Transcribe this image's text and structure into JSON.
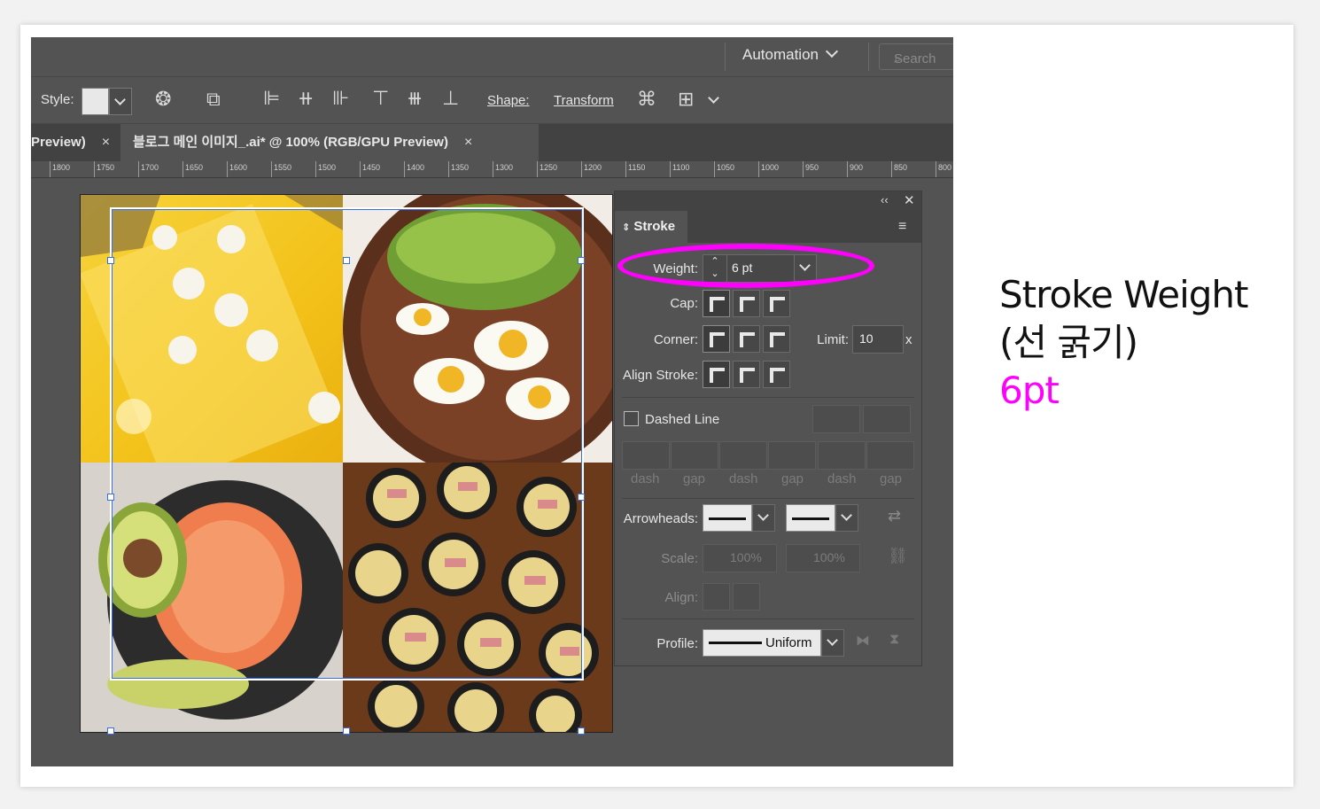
{
  "topbar": {
    "workspace": "Automation",
    "search_placeholder": "Search"
  },
  "control_bar": {
    "style_label": "Style:",
    "shape_label": "Shape:",
    "transform_label": "Transform"
  },
  "tabs": [
    {
      "label": "Preview)",
      "close": "×"
    },
    {
      "label": "블로그 메인 이미지_.ai* @ 100% (RGB/GPU Preview)",
      "close": "×"
    }
  ],
  "ruler_ticks": [
    "1800",
    "1750",
    "1700",
    "1650",
    "1600",
    "1550",
    "1500",
    "1450",
    "1400",
    "1350",
    "1300",
    "1250",
    "1200",
    "1150",
    "1100",
    "1050",
    "1000",
    "950",
    "900",
    "850",
    "800"
  ],
  "stroke_panel": {
    "title": "Stroke",
    "weight_label": "Weight:",
    "weight_value": "6 pt",
    "cap_label": "Cap:",
    "corner_label": "Corner:",
    "limit_label": "Limit:",
    "limit_value": "10",
    "limit_unit": "x",
    "align_label": "Align Stroke:",
    "dashed_label": "Dashed Line",
    "dash_labels": [
      "dash",
      "gap",
      "dash",
      "gap",
      "dash",
      "gap"
    ],
    "arrowheads_label": "Arrowheads:",
    "scale_label": "Scale:",
    "scale_values": [
      "100%",
      "100%"
    ],
    "align2_label": "Align:",
    "profile_label": "Profile:",
    "profile_value": "Uniform"
  },
  "annotation": {
    "line1": "Stroke Weight",
    "line2": "(선 굵기)",
    "line3": "6pt",
    "highlight_color": "#ff00ff"
  }
}
